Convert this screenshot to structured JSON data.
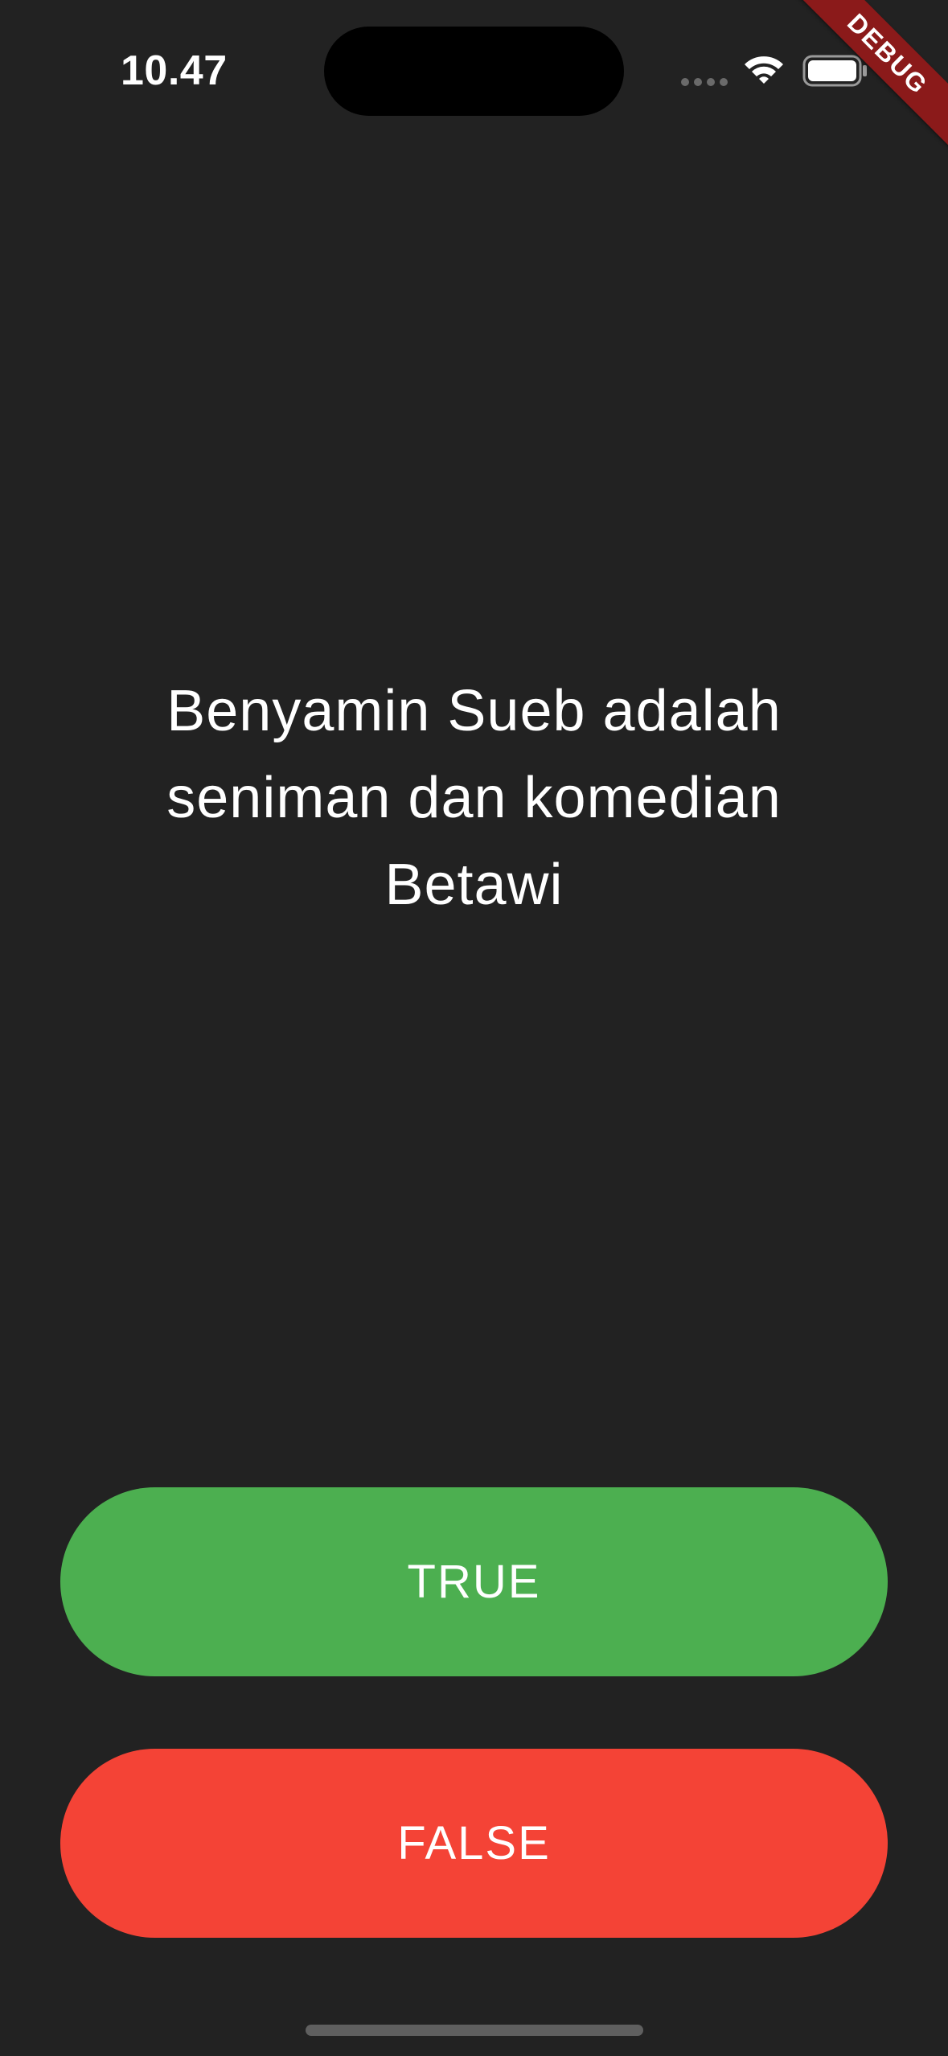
{
  "status_bar": {
    "time": "10.47",
    "icons": [
      "cellular-signal-icon",
      "wifi-icon",
      "battery-icon"
    ]
  },
  "debug_banner": {
    "label": "DEBUG"
  },
  "quiz": {
    "question": "Benyamin Sueb adalah seniman dan komedian Betawi"
  },
  "buttons": {
    "true_label": "TRUE",
    "false_label": "FALSE"
  },
  "colors": {
    "background": "#222222",
    "true_button": "#4caf50",
    "false_button": "#f44336",
    "debug_ribbon": "#8b1a1a"
  }
}
